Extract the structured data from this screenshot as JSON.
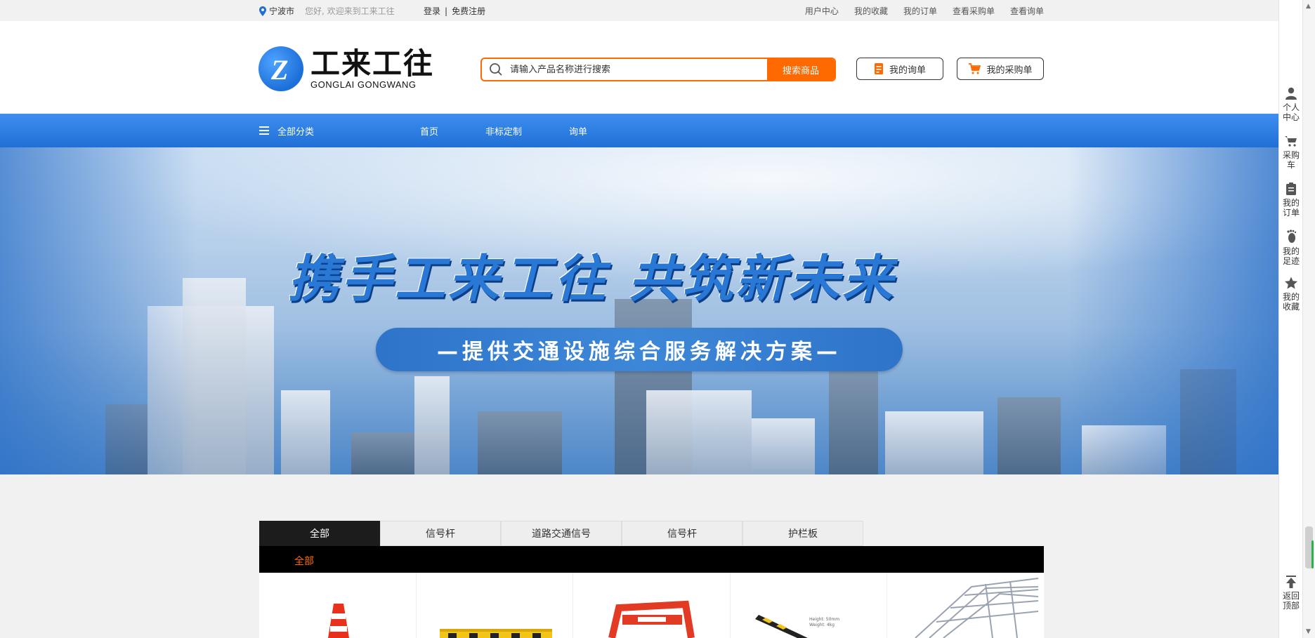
{
  "topbar": {
    "city": "宁波市",
    "welcome": "您好, 欢迎来到工来工往",
    "login": "登录",
    "separator": "|",
    "register": "免费注册",
    "links": [
      "用户中心",
      "我的收藏",
      "我的订单",
      "查看采购单",
      "查看询单"
    ]
  },
  "header": {
    "logo_cn": "工来工往",
    "logo_en": "GONGLAI GONGWANG",
    "search_placeholder": "请输入产品名称进行搜索",
    "search_button": "搜索商品",
    "inquiry_button": "我的询单",
    "cart_button": "我的采购单"
  },
  "nav": {
    "all_categories": "全部分类",
    "links": [
      "首页",
      "非标定制",
      "询单"
    ]
  },
  "banner": {
    "title": "携手工来工往  共筑新未来",
    "subtitle": "—提供交通设施综合服务解决方案—"
  },
  "sidebar": {
    "items": [
      {
        "label": "个人中心",
        "icon": "user-icon"
      },
      {
        "label": "采购车",
        "icon": "cart-icon"
      },
      {
        "label": "我的订单",
        "icon": "clipboard-icon"
      },
      {
        "label": "我的足迹",
        "icon": "footprint-icon"
      },
      {
        "label": "我的收藏",
        "icon": "star-icon"
      }
    ],
    "back_to_top": "返回顶部"
  },
  "categories": {
    "tabs": [
      "全部",
      "信号杆",
      "道路交通信号",
      "信号杆",
      "护栏板"
    ],
    "active": "全部",
    "sub_label": "全部"
  },
  "colors": {
    "accent": "#ff6a00",
    "nav_blue": "#2a7de0"
  }
}
